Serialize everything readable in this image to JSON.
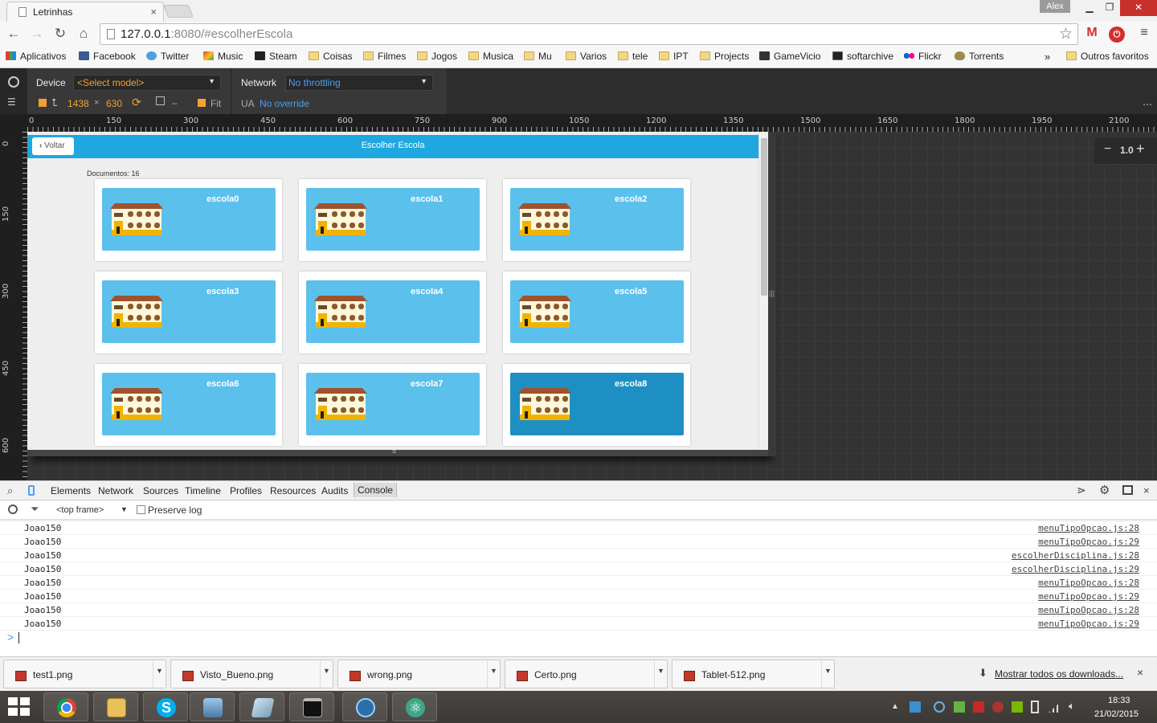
{
  "browser": {
    "tab_title": "Letrinhas",
    "tab_close": "×",
    "user": "Alex",
    "url_host": "127.0.0.1",
    "url_rest": ":8080/#escolherEscola"
  },
  "bookmarks": {
    "items": [
      "Aplicativos",
      "Facebook",
      "Twitter",
      "Music",
      "Steam",
      "Coisas",
      "Filmes",
      "Jogos",
      "Musica",
      "Mu",
      "Varios",
      "tele",
      "IPT",
      "Projects",
      "GameVicio",
      "softarchive",
      "Flickr",
      "Torrents"
    ],
    "overflow": "»",
    "others": "Outros favoritos"
  },
  "emulation": {
    "device_label": "Device",
    "device_select": "<Select model>",
    "width": "1438",
    "times": "×",
    "height": "630",
    "dash": "–",
    "fit": "Fit",
    "network_label": "Network",
    "network_select": "No throttling",
    "ua_label": "UA",
    "ua_value": "No override"
  },
  "ruler": {
    "top": [
      "0",
      "150",
      "300",
      "450",
      "600",
      "750",
      "900",
      "1050",
      "1200",
      "1350",
      "1500",
      "1650",
      "1800",
      "1950",
      "2100"
    ],
    "left": [
      "0",
      "150",
      "300",
      "450",
      "600"
    ]
  },
  "zoom": {
    "minus": "−",
    "value": "1.0",
    "plus": "+"
  },
  "app": {
    "back_label": "Voltar",
    "title": "Escolher Escola",
    "documents": "Documentos: 16",
    "schools": [
      "escola0",
      "escola1",
      "escola2",
      "escola3",
      "escola4",
      "escola5",
      "escola6",
      "escola7",
      "escola8"
    ],
    "active_index": 8
  },
  "devtools": {
    "tabs": [
      "Elements",
      "Network",
      "Sources",
      "Timeline",
      "Profiles",
      "Resources",
      "Audits",
      "Console"
    ],
    "active_tab": "Console",
    "frame": "<top frame>",
    "preserve_log": "Preserve log",
    "logs": [
      {
        "msg": "Joao150",
        "src": "menuTipoOpcao.js:28"
      },
      {
        "msg": "Joao150",
        "src": "menuTipoOpcao.js:29"
      },
      {
        "msg": "Joao150",
        "src": "escolherDisciplina.js:28"
      },
      {
        "msg": "Joao150",
        "src": "escolherDisciplina.js:29"
      },
      {
        "msg": "Joao150",
        "src": "menuTipoOpcao.js:28"
      },
      {
        "msg": "Joao150",
        "src": "menuTipoOpcao.js:29"
      },
      {
        "msg": "Joao150",
        "src": "menuTipoOpcao.js:28"
      },
      {
        "msg": "Joao150",
        "src": "menuTipoOpcao.js:29"
      }
    ],
    "prompt": ">"
  },
  "downloads": {
    "files": [
      "test1.png",
      "Visto_Bueno.png",
      "wrong.png",
      "Certo.png",
      "Tablet-512.png"
    ],
    "show_all": "Mostrar todos os downloads...",
    "close": "×"
  },
  "taskbar": {
    "time": "18:33",
    "date": "21/02/2015"
  },
  "colors": {
    "app_header": "#1fa7e0",
    "tile": "#5cc0ec",
    "tile_active": "#1e8fc2",
    "devtools_dark": "#2d2d2d"
  }
}
